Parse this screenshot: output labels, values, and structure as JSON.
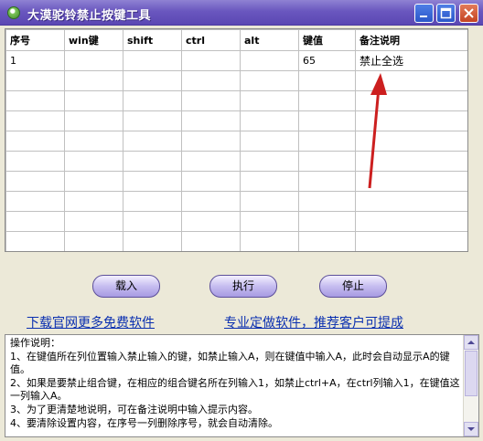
{
  "window": {
    "title": "大漠驼铃禁止按键工具"
  },
  "grid": {
    "headers": [
      "序号",
      "win键",
      "shift",
      "ctrl",
      "alt",
      "键值",
      "备注说明"
    ],
    "rows": [
      [
        "1",
        "",
        "",
        "",
        "",
        "65",
        "禁止全选"
      ]
    ]
  },
  "buttons": {
    "load": "载入",
    "run": "执行",
    "stop": "停止"
  },
  "links": {
    "more": "下载官网更多免费软件",
    "custom": "专业定做软件，推荐客户可提成"
  },
  "instructions": {
    "lines": [
      "操作说明：",
      "1、在键值所在列位置输入禁止输入的键，如禁止输入A，则在键值中输入A，此时会自动显示A的键值。",
      "2、如果是要禁止组合键，在相应的组合键名所在列输入1，如禁止ctrl+A，在ctrl列输入1，在键值这一列输入A。",
      "3、为了更清楚地说明，可在备注说明中输入提示内容。",
      "4、要清除设置内容，在序号一列删除序号，就会自动清除。"
    ]
  },
  "colors": {
    "titlebar": "#6a57bf",
    "arrow": "#cc1f1f",
    "link": "#0a2fb0",
    "button": "#c6bdf0"
  }
}
